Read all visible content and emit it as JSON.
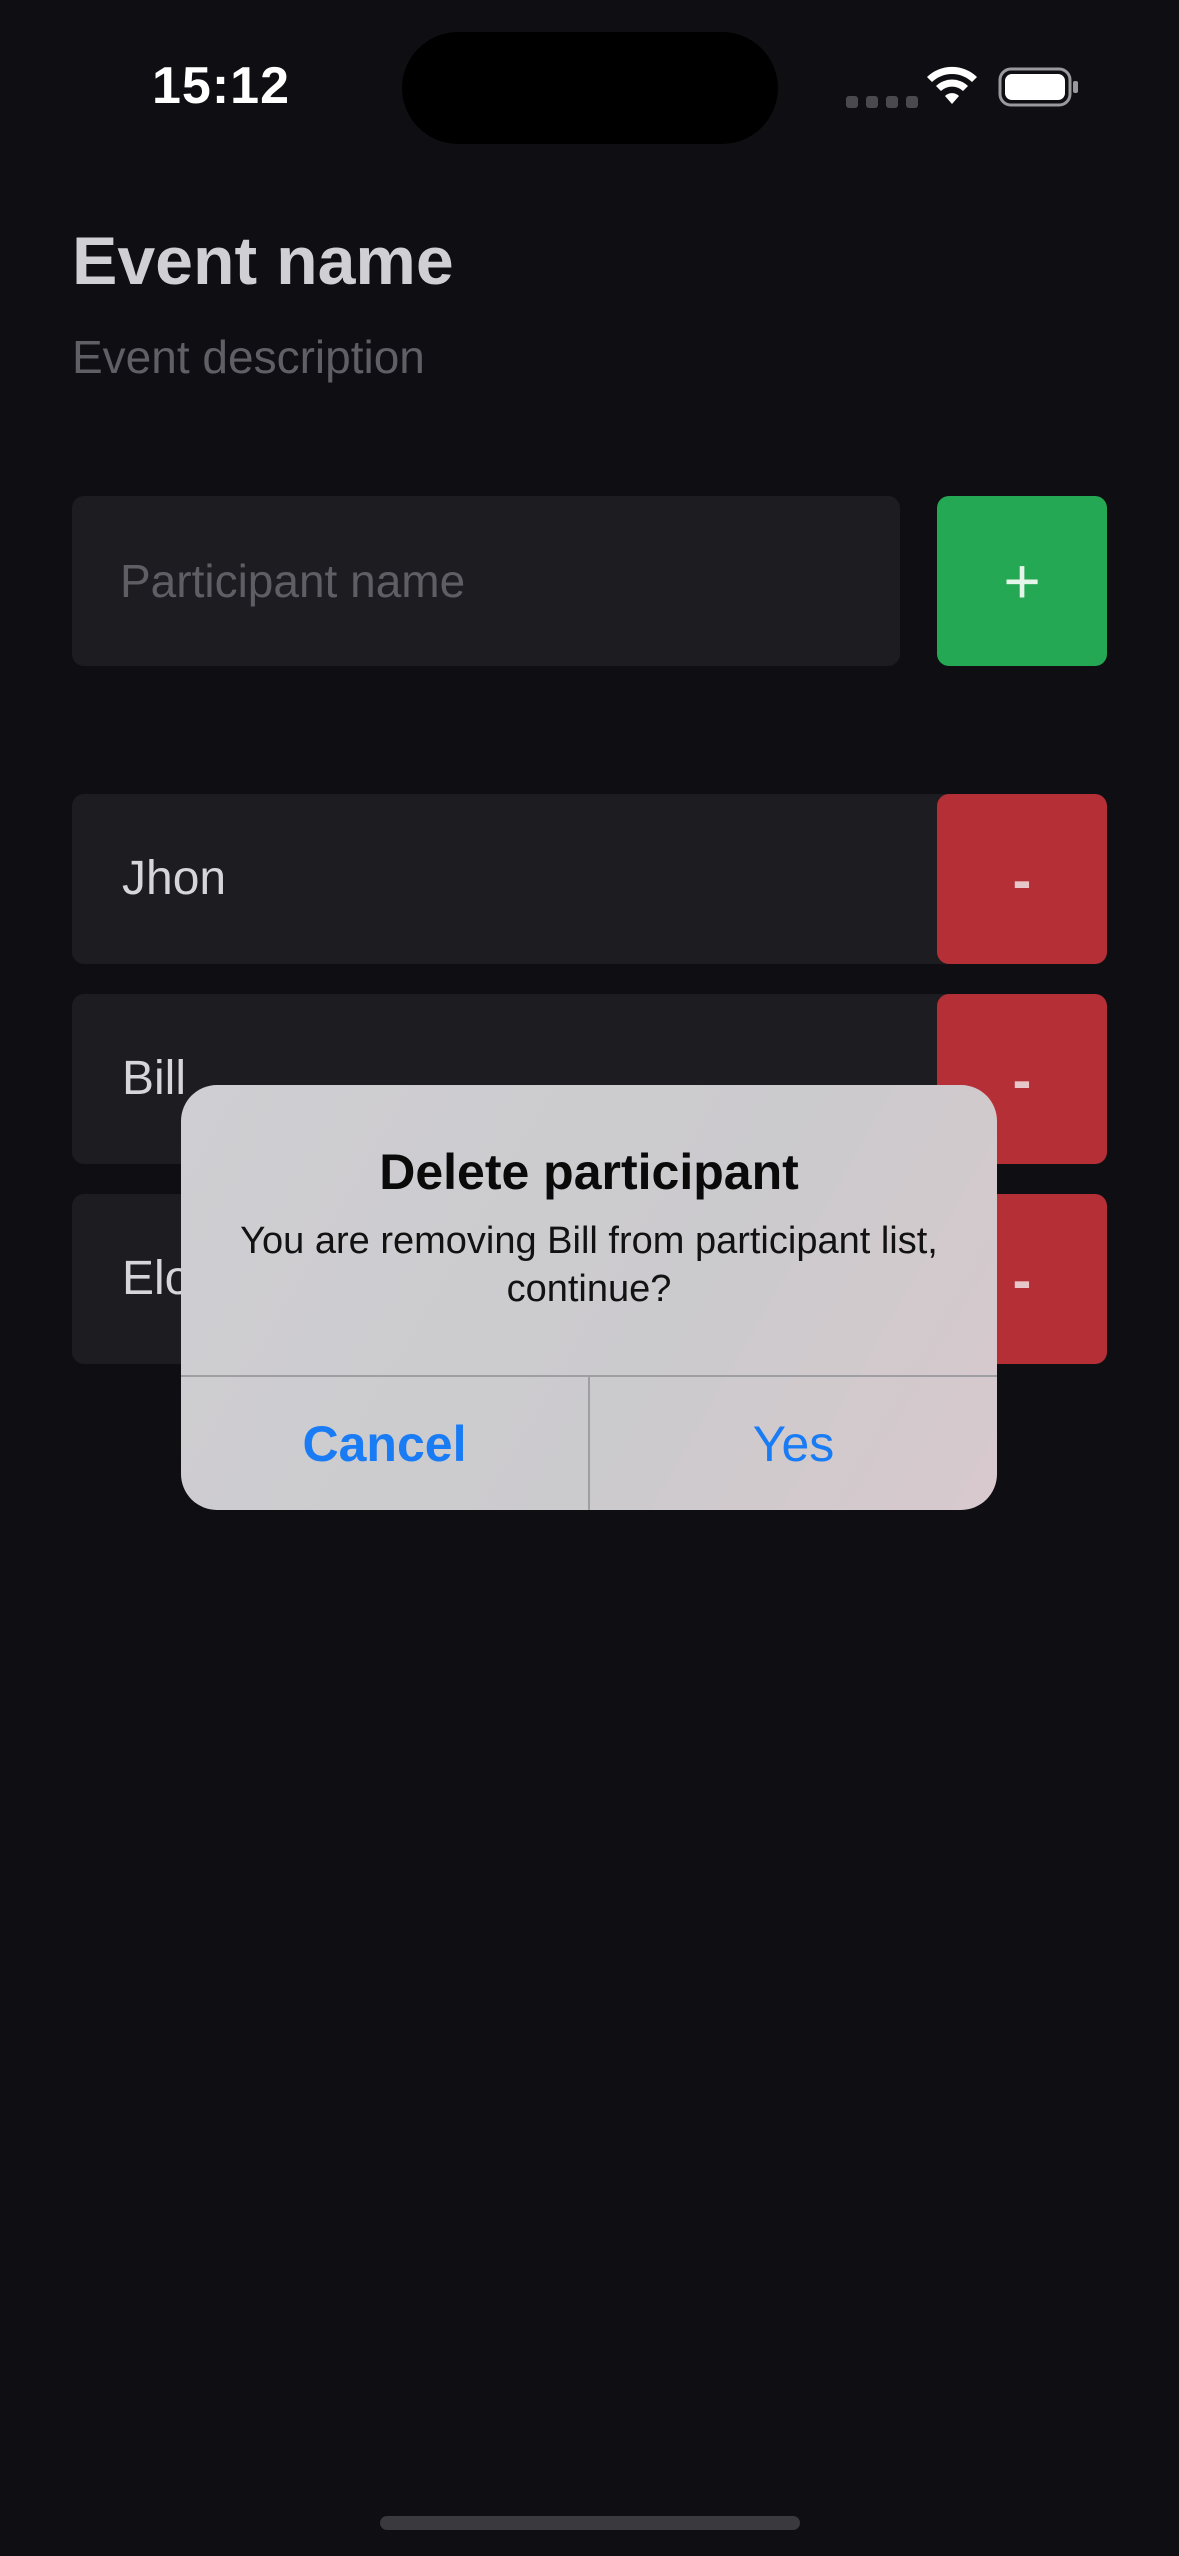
{
  "status_bar": {
    "time": "15:12",
    "icons": [
      "cellular-signal-icon",
      "wifi-icon",
      "battery-icon"
    ]
  },
  "event": {
    "title": "Event name",
    "description": "Event description"
  },
  "add_participant": {
    "placeholder": "Participant name",
    "value": "",
    "add_label": "+"
  },
  "participants": [
    {
      "name": "Jhon",
      "remove_label": "-"
    },
    {
      "name": "Bill",
      "remove_label": "-"
    },
    {
      "name": "Elo",
      "remove_label": "-"
    }
  ],
  "alert": {
    "title": "Delete participant",
    "message": "You are removing Bill from participant list, continue?",
    "cancel_label": "Cancel",
    "confirm_label": "Yes"
  },
  "colors": {
    "background": "#0f0e13",
    "add_button": "#24a853",
    "remove_button": "#b52f37",
    "alert_action": "#1a7cf5"
  }
}
